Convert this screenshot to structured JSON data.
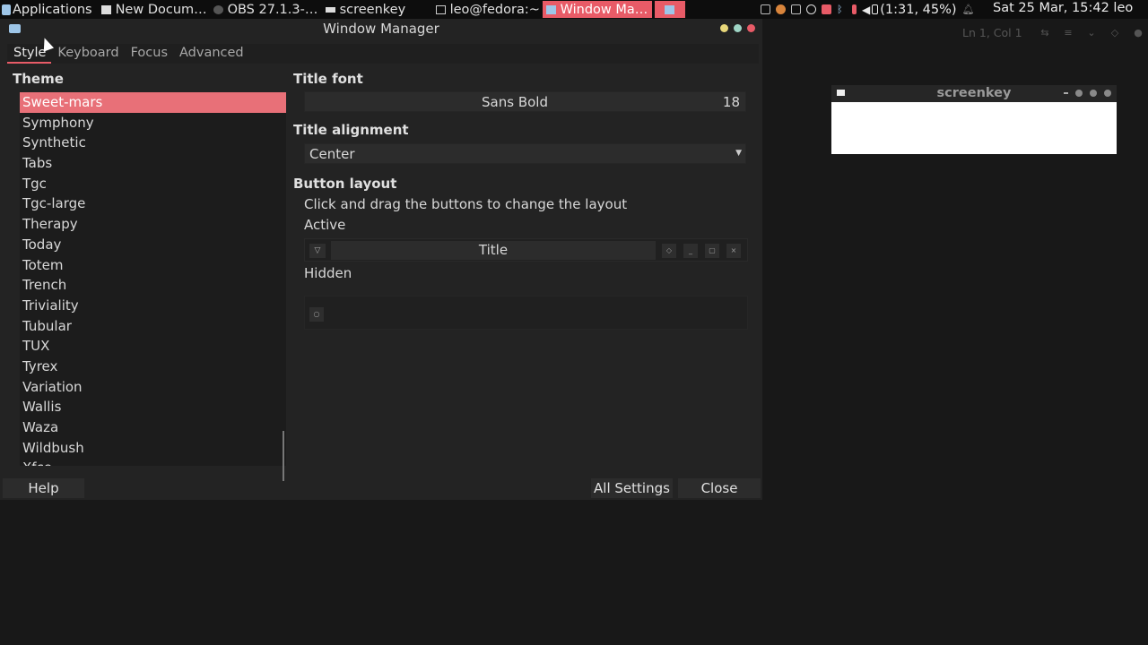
{
  "panel": {
    "applications": "Applications",
    "tasks": [
      "New Docum…",
      "OBS 27.1.3-…",
      "screenkey",
      "leo@fedora:~",
      "Window Ma…"
    ],
    "battery": "(1:31, 45%)",
    "clock": "Sat 25 Mar, 15:42",
    "user": "leo"
  },
  "window": {
    "title": "Window Manager",
    "tabs": [
      "Style",
      "Keyboard",
      "Focus",
      "Advanced"
    ],
    "theme_label": "Theme",
    "themes": [
      "Sweet-mars",
      "Symphony",
      "Synthetic",
      "Tabs",
      "Tgc",
      "Tgc-large",
      "Therapy",
      "Today",
      "Totem",
      "Trench",
      "Triviality",
      "Tubular",
      "TUX",
      "Tyrex",
      "Variation",
      "Wallis",
      "Waza",
      "Wildbush",
      "Xfce"
    ],
    "title_font_label": "Title font",
    "title_font": "Sans Bold",
    "title_font_size": "18",
    "title_alignment_label": "Title alignment",
    "title_alignment": "Center",
    "button_layout_label": "Button layout",
    "button_layout_hint": "Click and drag the buttons to change the layout",
    "active_label": "Active",
    "title_button": "Title",
    "hidden_label": "Hidden",
    "help": "Help",
    "all_settings": "All Settings",
    "close": "Close"
  },
  "editor": {
    "position": "Ln 1, Col 1"
  },
  "screenkey": {
    "title": "screenkey"
  },
  "colors": {
    "accent": "#e85b67",
    "selection": "#e87078",
    "minimize_dot": "#e8d77a",
    "maximize_dot": "#9fd6c6",
    "close_dot": "#e85b67"
  }
}
